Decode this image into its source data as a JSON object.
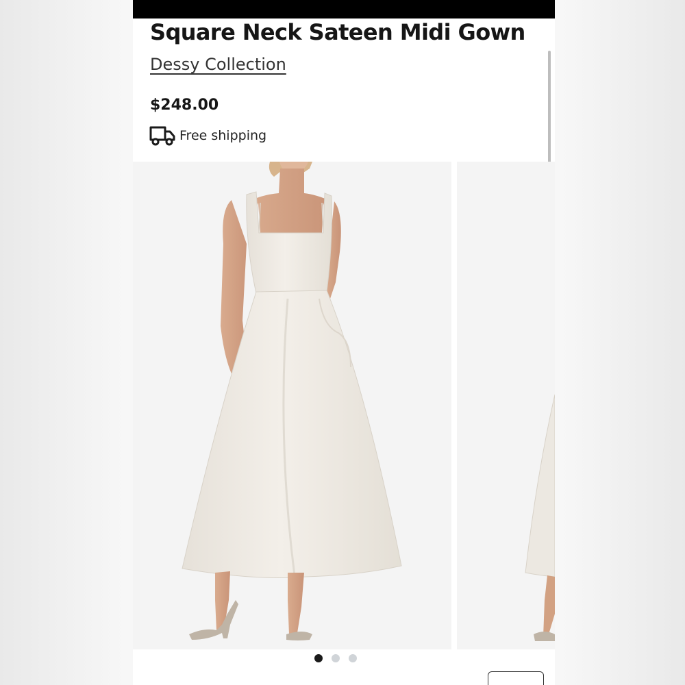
{
  "product": {
    "title": "Square Neck Sateen Midi Gown",
    "brand": "Dessy Collection",
    "price": "$248.00",
    "shipping_label": "Free shipping",
    "shipping_icon": "truck-icon"
  },
  "carousel": {
    "slide_count": 3,
    "active_index": 0,
    "slides": [
      {
        "alt": "model-wearing-ivory-midi-gown-front"
      },
      {
        "alt": "model-wearing-ivory-midi-gown-partial"
      }
    ]
  },
  "colors": {
    "text_primary": "#161616",
    "dot_active": "#1a1a1a",
    "dot_inactive": "#d0d4d8",
    "photo_background": "#f4f4f4",
    "gown": "#efebe4"
  }
}
